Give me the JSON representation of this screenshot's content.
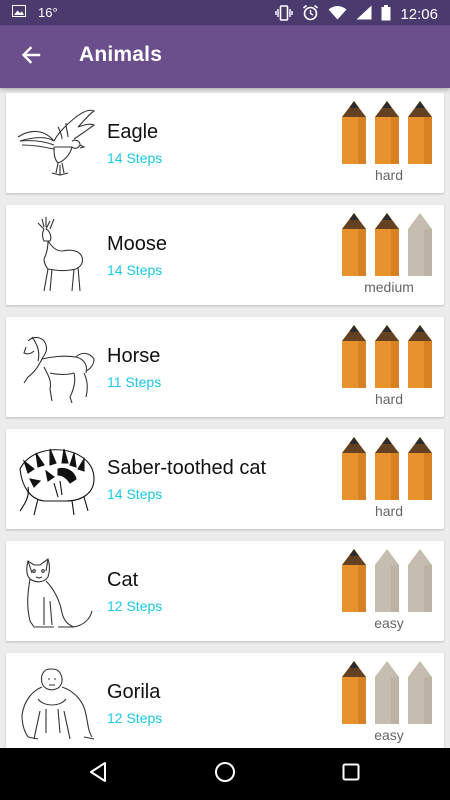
{
  "status_bar": {
    "temperature": "16°",
    "time": "12:06",
    "icons": [
      "image-icon",
      "vibrate-icon",
      "alarm-icon",
      "wifi-icon",
      "signal-icon",
      "battery-icon"
    ]
  },
  "app_bar": {
    "title": "Animals",
    "back_icon": "arrow-back-icon"
  },
  "colors": {
    "status_bar": "#4a3a6d",
    "app_bar": "#6b4f8c",
    "steps_text": "#1cc6e6",
    "pencil_active": "#e8922e",
    "pencil_inactive": "#c6bdb1",
    "background": "#ececec"
  },
  "animals": [
    {
      "name": "Eagle",
      "steps": "14 Steps",
      "difficulty": "hard",
      "level": 3,
      "max_level": 3
    },
    {
      "name": "Moose",
      "steps": "14 Steps",
      "difficulty": "medium",
      "level": 2,
      "max_level": 3
    },
    {
      "name": "Horse",
      "steps": "11 Steps",
      "difficulty": "hard",
      "level": 3,
      "max_level": 3
    },
    {
      "name": "Saber-toothed cat",
      "steps": "14 Steps",
      "difficulty": "hard",
      "level": 3,
      "max_level": 3
    },
    {
      "name": "Cat",
      "steps": "12 Steps",
      "difficulty": "easy",
      "level": 1,
      "max_level": 3
    },
    {
      "name": "Gorila",
      "steps": "12 Steps",
      "difficulty": "easy",
      "level": 1,
      "max_level": 3
    }
  ],
  "nav_bar": {
    "icons": [
      "back-triangle-icon",
      "home-circle-icon",
      "recents-square-icon"
    ]
  }
}
